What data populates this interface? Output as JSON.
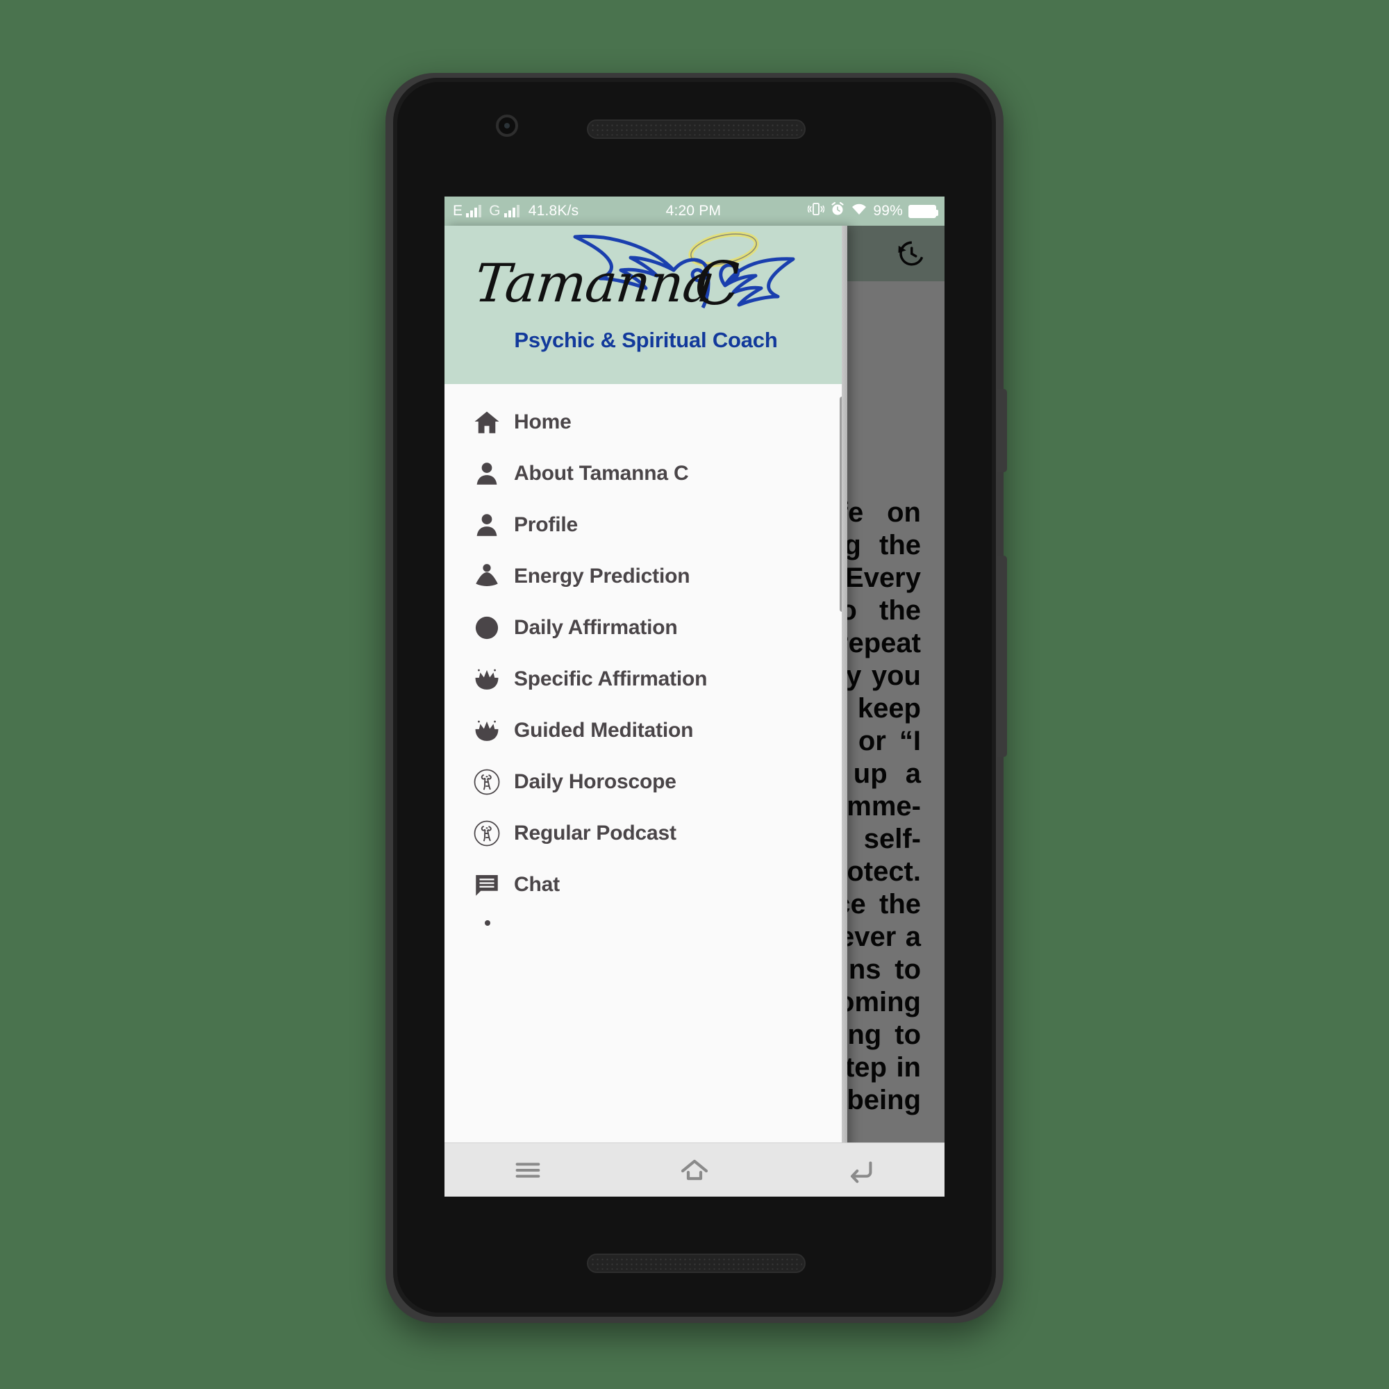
{
  "device": {
    "type": "android-phone",
    "front_camera": "camera-icon",
    "earpiece": "speaker-grille",
    "bottom_speaker": "speaker-grille",
    "buttons": [
      "power-button",
      "volume-rocker"
    ]
  },
  "statusbar": {
    "network_type_1": "E",
    "network_type_2": "G",
    "data_speed": "41.8K/s",
    "time": "4:20 PM",
    "icons": [
      "vibrate-icon",
      "alarm-icon",
      "wifi-icon"
    ],
    "battery_percent": "99%"
  },
  "appbar": {
    "history_icon": "history-icon"
  },
  "drawer": {
    "logo": {
      "brand": "Tamanna",
      "brand_initial": "C",
      "tagline": "Psychic & Spiritual Coach",
      "header_bg": "#c3dbcd",
      "tagline_color": "#12399b",
      "wing_color": "#1a3fae",
      "halo_color": "#e3e07a"
    },
    "items": [
      {
        "label": "Home",
        "icon": "home-icon"
      },
      {
        "label": "About Tamanna C",
        "icon": "person-icon"
      },
      {
        "label": "Profile",
        "icon": "person-icon"
      },
      {
        "label": "Energy Prediction",
        "icon": "meditating-person-icon"
      },
      {
        "label": "Daily Affirmation",
        "icon": "circle-icon"
      },
      {
        "label": "Specific Affirmation",
        "icon": "lotus-icon"
      },
      {
        "label": "Guided Meditation",
        "icon": "lotus-icon"
      },
      {
        "label": "Daily Horoscope",
        "icon": "aries-zodiac-icon"
      },
      {
        "label": "Regular Podcast",
        "icon": "aries-zodiac-icon"
      },
      {
        "label": "Chat",
        "icon": "chat-bubble-icon"
      }
    ]
  },
  "content": {
    "paragraph": "Most people live their life on autopilot, never questioning the beliefs they inherited. Every thought is a statement to the universe. The words you repeat have an impact on the reality you build around you. If you keep telling yourself “I can’t do” or “I am not enough”, you set up a limiting frame that the mind imme- diately accepts as the true self-image and then works to protect. Another practice is to notice the feelings that come up whenever a new image of yourself begins to form in your mind. Becoming aware of what you are saying to yourself is the first mental step in releasing the old belief of being “not",
    "scrim_color": "#000000"
  },
  "navbar": {
    "buttons": [
      {
        "name": "recents-button",
        "icon": "menu-icon"
      },
      {
        "name": "home-button",
        "icon": "home-outline-icon"
      },
      {
        "name": "back-button",
        "icon": "back-arrow-icon"
      }
    ]
  },
  "colors": {
    "page_background": "#4a734e",
    "drawer_background": "#fafafa",
    "menu_text": "#4a4548",
    "navbar_background": "#e6e6e6"
  }
}
